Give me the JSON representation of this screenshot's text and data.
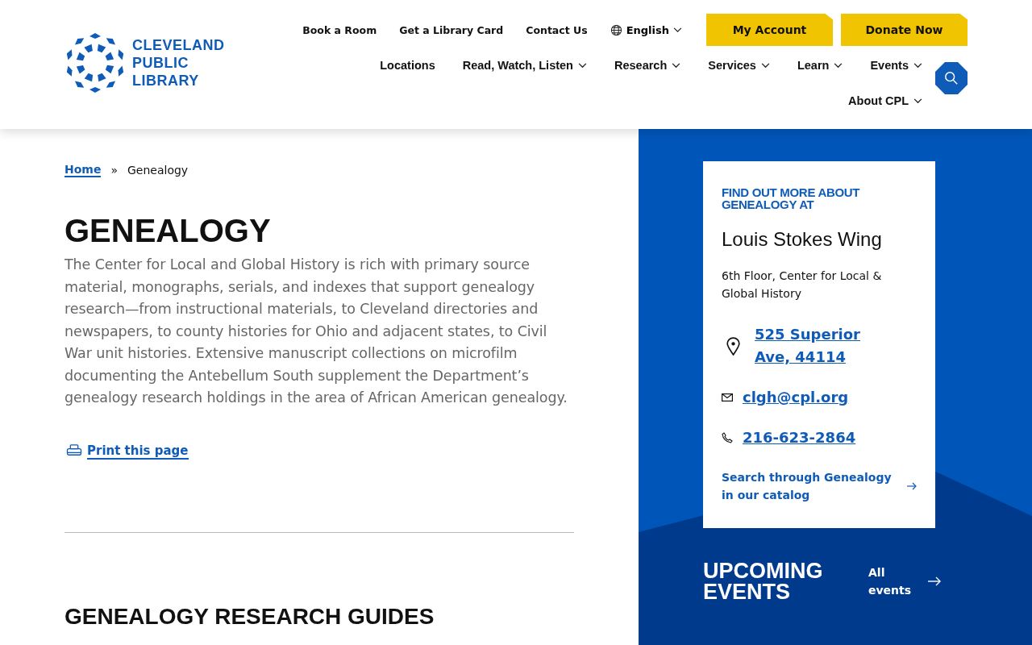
{
  "logo": {
    "lines": [
      "CLEVELAND",
      "PUBLIC",
      "LIBRARY"
    ]
  },
  "utility_links": [
    "Book a Room",
    "Get a Library Card",
    "Contact Us"
  ],
  "language": {
    "label": "English"
  },
  "action_buttons": [
    "My Account",
    "Donate Now"
  ],
  "main_nav": [
    {
      "label": "Locations",
      "dropdown": false
    },
    {
      "label": "Read, Watch, Listen",
      "dropdown": true
    },
    {
      "label": "Research",
      "dropdown": true
    },
    {
      "label": "Services",
      "dropdown": true
    },
    {
      "label": "Learn",
      "dropdown": true
    },
    {
      "label": "Events",
      "dropdown": true
    },
    {
      "label": "About CPL",
      "dropdown": true
    }
  ],
  "breadcrumb": [
    {
      "label": "Home",
      "link": true
    },
    {
      "label": "Genealogy",
      "link": false
    }
  ],
  "breadcrumb_separator": "»",
  "title": "GENEALOGY",
  "intro": "The Center for Local and Global History is rich with primary source material, monographs, serials, and indexes that support genealogy research—from instructional materials, to Cleveland directories and newspapers, to county histories for Ohio and adjacent states, to Civil War unit histories. Extensive manuscript collections on microfilm documenting the Antebellum South supplement the Department’s genealogy research holdings in the area of African American genealogy.",
  "print_link": "Print this page",
  "section_heading": "GENEALOGY RESEARCH GUIDES",
  "info_card": {
    "eyebrow": "FIND OUT MORE ABOUT GENEALOGY AT",
    "location": "Louis Stokes Wing",
    "floor": "6th Floor, Center for Local & Global History",
    "contacts": [
      {
        "kind": "address",
        "text": "525 Superior Ave, 44114"
      },
      {
        "kind": "email",
        "text": "clgh@cpl.org"
      },
      {
        "kind": "phone",
        "text": "216-623-2864"
      }
    ],
    "catalog_link": "Search through Genealogy in our catalog"
  },
  "events": {
    "heading": "UPCOMING EVENTS",
    "link": "All events"
  }
}
